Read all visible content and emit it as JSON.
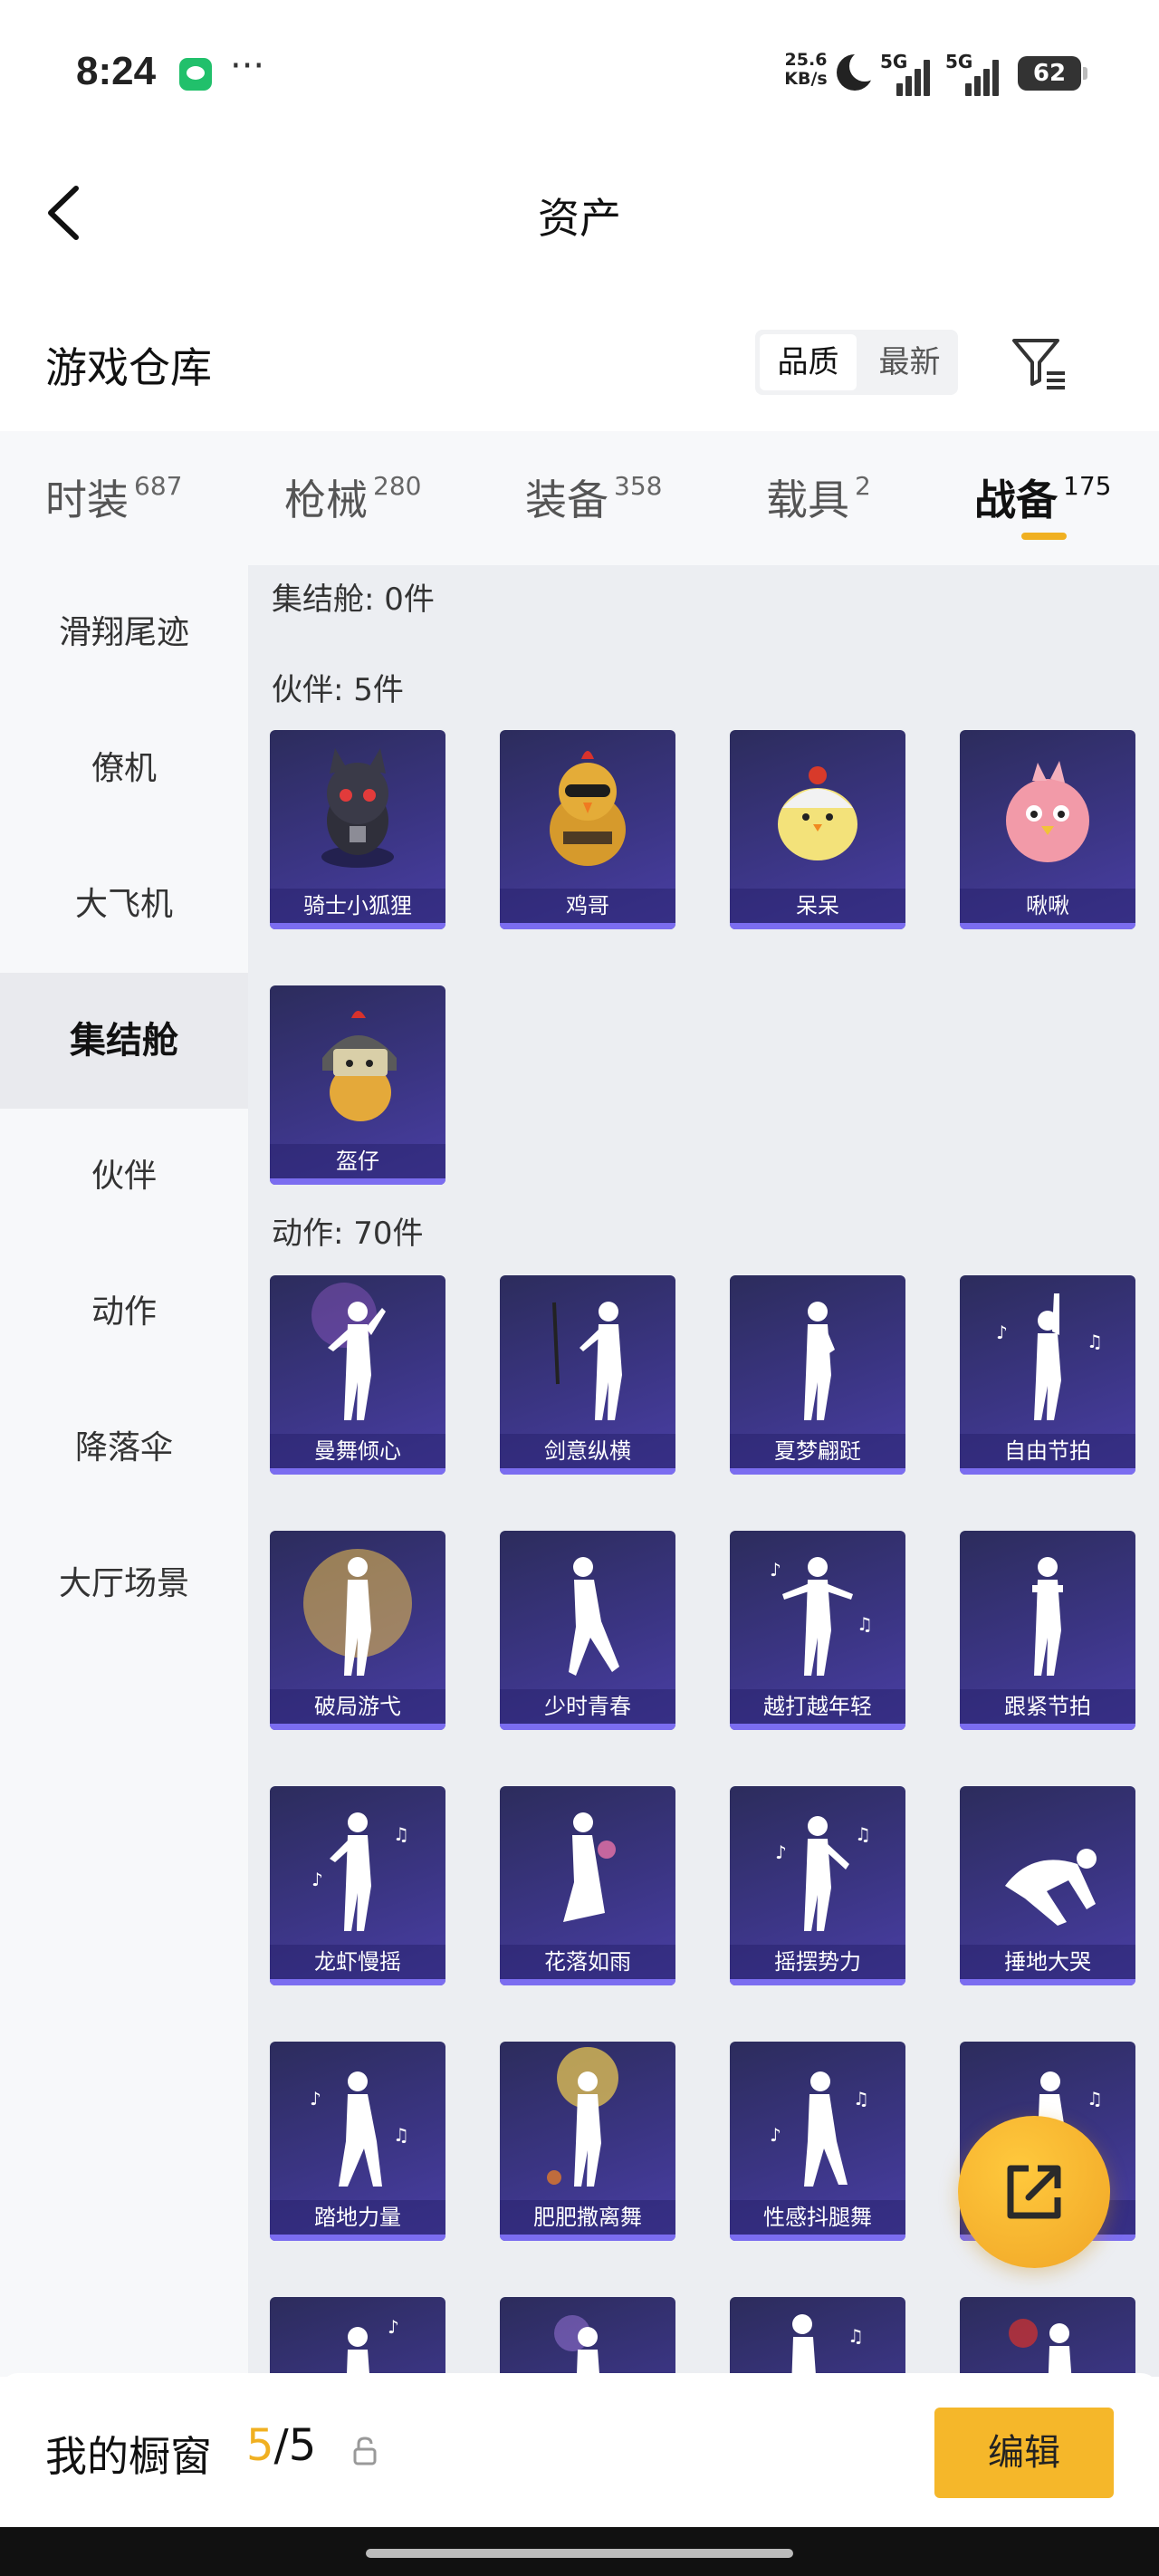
{
  "status_bar": {
    "time": "8:24",
    "net_speed_value": "25.6",
    "net_speed_unit": "KB/s",
    "signal1_label": "5G",
    "signal2_label": "5G",
    "battery": "62",
    "icons": [
      "wechat-icon",
      "more-dots-icon",
      "moon-icon",
      "signal-icon",
      "battery-icon"
    ]
  },
  "header": {
    "title": "资产",
    "back_icon": "chevron-left-icon"
  },
  "section": {
    "title": "游戏仓库",
    "sort_options": [
      "品质",
      "最新"
    ],
    "sort_selected": "品质",
    "filter_icon": "filter-icon"
  },
  "tabs": [
    {
      "label": "时装",
      "count": "687"
    },
    {
      "label": "枪械",
      "count": "280"
    },
    {
      "label": "装备",
      "count": "358"
    },
    {
      "label": "载具",
      "count": "2"
    },
    {
      "label": "战备",
      "count": "175",
      "active": true
    }
  ],
  "sidebar": {
    "items": [
      "滑翔尾迹",
      "僚机",
      "大飞机",
      "集结舱",
      "伙伴",
      "动作",
      "降落伞",
      "大厅场景"
    ],
    "active": "集结舱"
  },
  "content": {
    "groups": [
      {
        "label": "集结舱: 0件",
        "items": []
      },
      {
        "label": "伙伴: 5件",
        "items": [
          "骑士小狐狸",
          "鸡哥",
          "呆呆",
          "啾啾",
          "盔仔"
        ]
      },
      {
        "label": "动作: 70件",
        "items": [
          "曼舞倾心",
          "剑意纵横",
          "夏梦翩跹",
          "自由节拍",
          "破局游弋",
          "少时青春",
          "越打越年轻",
          "跟紧节拍",
          "龙虾慢摇",
          "花落如雨",
          "摇摆势力",
          "捶地大哭",
          "踏地力量",
          "肥肥撒离舞",
          "性感抖腿舞",
          "",
          "",
          "",
          "",
          ""
        ]
      }
    ]
  },
  "bottom_bar": {
    "label": "我的橱窗",
    "current": "5",
    "total": "/5",
    "lock_icon": "lock-icon",
    "edit_label": "编辑"
  },
  "fab": {
    "icon": "share-external-icon"
  },
  "colors": {
    "accent": "#f0b021",
    "card_bg": "#3b3584",
    "card_strip": "#7b6df0"
  }
}
